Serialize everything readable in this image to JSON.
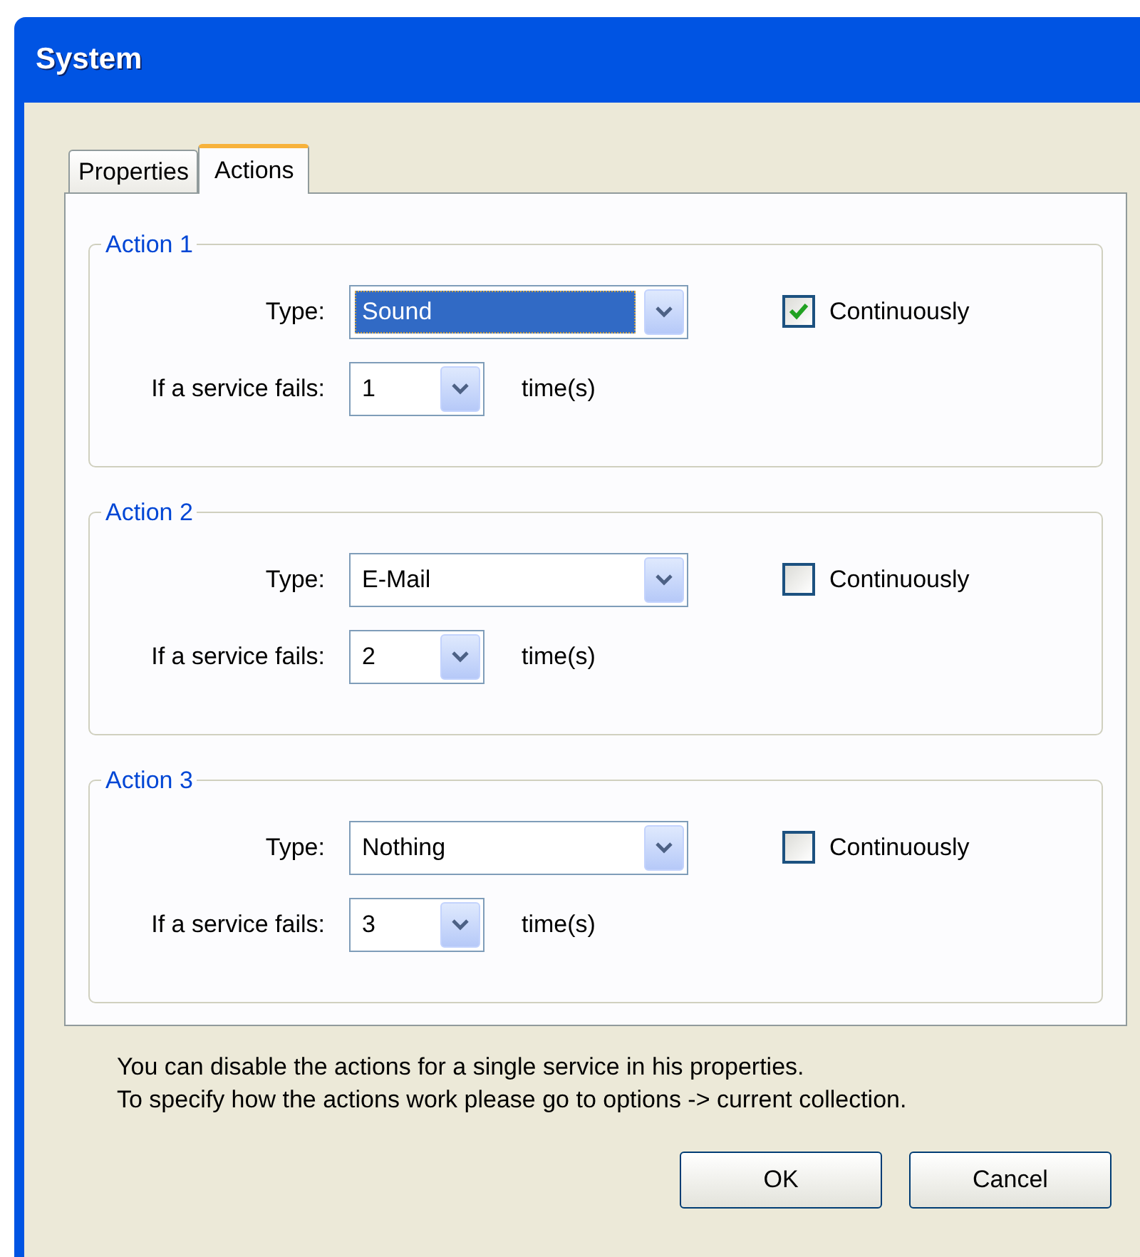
{
  "window": {
    "title": "System"
  },
  "tabs": [
    {
      "label": "Properties",
      "selected": false
    },
    {
      "label": "Actions",
      "selected": true
    }
  ],
  "actions": [
    {
      "title": "Action 1",
      "type_label": "Type:",
      "type_value": "Sound",
      "type_focused": true,
      "continuously": {
        "label": "Continuously",
        "checked": true
      },
      "fails_label": "If a service fails:",
      "fails_value": "1",
      "unit": "time(s)"
    },
    {
      "title": "Action 2",
      "type_label": "Type:",
      "type_value": "E-Mail",
      "type_focused": false,
      "continuously": {
        "label": "Continuously",
        "checked": false
      },
      "fails_label": "If a service fails:",
      "fails_value": "2",
      "unit": "time(s)"
    },
    {
      "title": "Action 3",
      "type_label": "Type:",
      "type_value": "Nothing",
      "type_focused": false,
      "continuously": {
        "label": "Continuously",
        "checked": false
      },
      "fails_label": "If a service fails:",
      "fails_value": "3",
      "unit": "time(s)"
    }
  ],
  "notes": [
    "You can disable the actions for a single service in his properties.",
    "To specify how the actions work please go to options -> current collection."
  ],
  "buttons": [
    "OK",
    "Cancel"
  ]
}
